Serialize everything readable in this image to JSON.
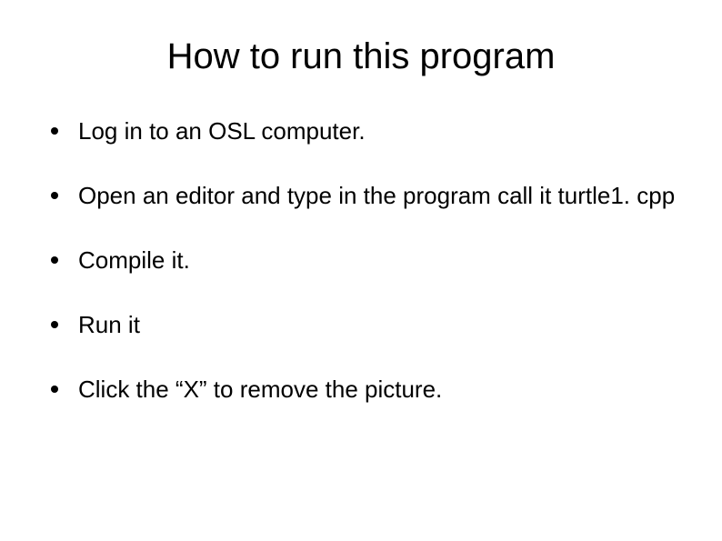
{
  "title": "How to run this program",
  "bullets": [
    "Log in to an OSL computer.",
    "Open an editor and type in the program call it turtle1. cpp",
    "Compile it.",
    "Run it",
    "Click the “X” to remove the picture."
  ]
}
